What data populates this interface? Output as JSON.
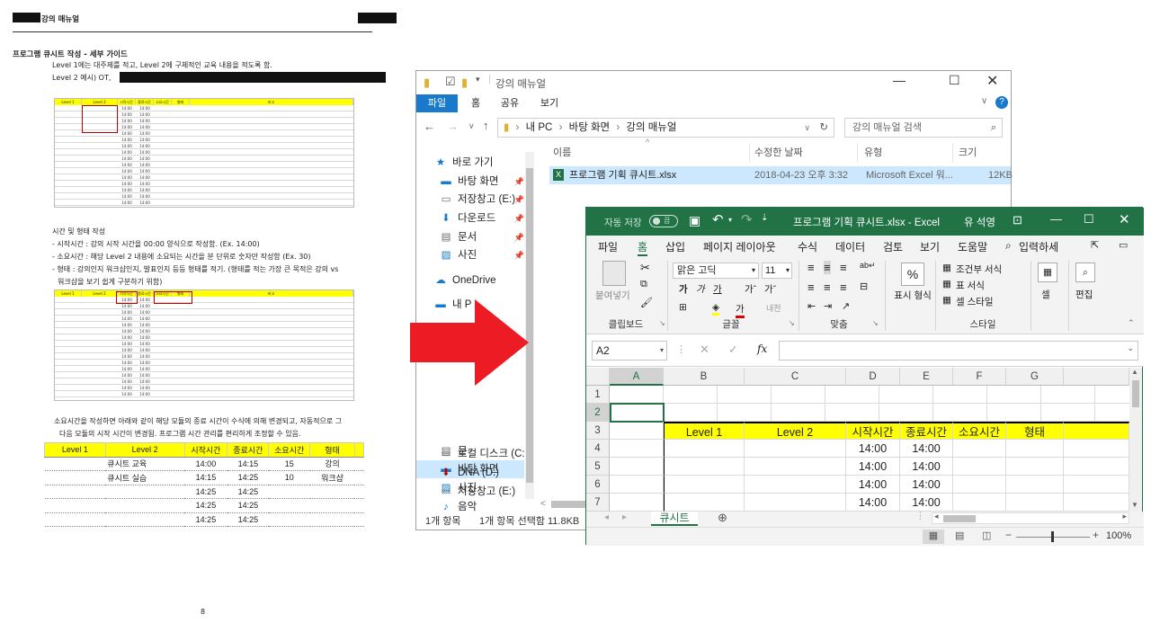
{
  "doc": {
    "header_title": "강의 매뉴얼",
    "section_title": "프로그램 큐시트 작성 - 세부 가이드",
    "intro_line1": "Level 1에는 대주제를 적고, Level 2에 구체적인 교육 내용을 적도록 함.",
    "intro_line2_prefix": "Level 2 예시) OT,",
    "mini_table1": {
      "headers": [
        "Level 1",
        "Level 2",
        "시작시간",
        "종료시간",
        "소요시간",
        "형태",
        "비고"
      ],
      "times": [
        "14:00",
        "14:00",
        "14:00",
        "14:00",
        "14:00",
        "14:00",
        "14:00",
        "14:00",
        "14:00",
        "14:00",
        "14:00",
        "14:00",
        "14:00",
        "14:00",
        "14:00",
        "14:00"
      ]
    },
    "time_section_title": "시간 및 형태 작성",
    "bullet1": "- 시작시간 : 강의 시작 시간을 00:00 양식으로 작성함. (Ex. 14:00)",
    "bullet2": "- 소요시간 : 해당 Level 2 내용에 소요되는 시간을 분 단위로 숫자만 작성함 (Ex. 30)",
    "bullet3a": "- 형태 : 강의인지 워크샵인지, 발표인지 등등 형태를 적기. (형태를 적는 가장 큰 목적은 강의 vs",
    "bullet3b": "워크샵을 보기 쉽게 구분하기 위함)",
    "para_a": "소요시간을 작성하면 아래와 같이 해당 모듈의 종료 시간이 수식에 의해 변경되고, 자동적으로 그",
    "para_b": "다음 모듈의 시작 시간이 변경됨. 프로그램 시간 관리를 편리하게 조정할 수 있음.",
    "table": {
      "headers": [
        "Level 1",
        "Level 2",
        "시작시간",
        "종료시간",
        "소요시간",
        "형태"
      ],
      "rows": [
        [
          "",
          "큐시트 교육",
          "14:00",
          "14:15",
          "15",
          "강의"
        ],
        [
          "",
          "큐시트 실습",
          "14:15",
          "14:25",
          "10",
          "워크샵"
        ],
        [
          "",
          "",
          "14:25",
          "14:25",
          "",
          ""
        ],
        [
          "",
          "",
          "14:25",
          "14:25",
          "",
          ""
        ],
        [
          "",
          "",
          "14:25",
          "14:25",
          "",
          ""
        ]
      ]
    },
    "page_number": "8"
  },
  "explorer": {
    "title": "강의 매뉴얼",
    "tabs": [
      "파일",
      "홈",
      "공유",
      "보기"
    ],
    "breadcrumb": [
      "내 PC",
      "바탕 화면",
      "강의 매뉴얼"
    ],
    "search_placeholder": "강의 매뉴얼 검색",
    "columns": [
      "이름",
      "수정한 날짜",
      "유형",
      "크기"
    ],
    "file": {
      "name": "프로그램 기획 큐시트.xlsx",
      "date": "2018-04-23 오후 3:32",
      "type": "Microsoft Excel 워...",
      "size": "12KB"
    },
    "nav": {
      "quick_access": "바로 가기",
      "items": [
        "바탕 화면",
        "저장창고 (E:)",
        "다운로드",
        "문서",
        "사진"
      ],
      "onedrive": "OneDrive",
      "this_pc_partial": "내 P",
      "docs_partial": "문",
      "desktop": "바탕 화면",
      "pictures": "사진",
      "music": "음악",
      "local_disk": "로컬 디스크 (C:)",
      "dna": "DNA (D:)",
      "storage": "저장창고 (E:)"
    },
    "status_count": "1개 항목",
    "status_selected": "1개 항목 선택함 11.8KB"
  },
  "excel": {
    "autosave": "자동 저장",
    "autosave_state": "끔",
    "title": "프로그램 기획 큐시트.xlsx  -  Excel",
    "user": "유 석영",
    "menu": [
      "파일",
      "홈",
      "삽입",
      "페이지 레이아웃",
      "수식",
      "데이터",
      "검토",
      "보기",
      "도움말"
    ],
    "tell_me": "입력하세",
    "font_name": "맑은 고딕",
    "font_size": "11",
    "groups": {
      "clipboard": "클립보드",
      "font": "글꼴",
      "align": "맞춤",
      "styles": "스타일"
    },
    "paste": "붙여넣기",
    "number_format": "표시 형식",
    "cond_format": "조건부 서식",
    "table_format": "표 서식",
    "cell_style": "셀 스타일",
    "cells": "셀",
    "editing": "편집",
    "name_box": "A2",
    "fx": "fx",
    "columns": [
      "A",
      "B",
      "C",
      "D",
      "E",
      "F",
      "G"
    ],
    "rows": [
      "1",
      "2",
      "3",
      "4",
      "5",
      "6",
      "7"
    ],
    "header_row": [
      "Level 1",
      "Level 2",
      "시작시간",
      "종료시간",
      "소요시간",
      "형태"
    ],
    "data_rows": [
      [
        "",
        "",
        "14:00",
        "14:00",
        "",
        ""
      ],
      [
        "",
        "",
        "14:00",
        "14:00",
        "",
        ""
      ],
      [
        "",
        "",
        "14:00",
        "14:00",
        "",
        ""
      ],
      [
        "",
        "",
        "14:00",
        "14:00",
        "",
        ""
      ]
    ],
    "sheet_tab": "큐시트",
    "zoom": "100%",
    "colors": {
      "green": "#217346",
      "yellow": "#ffff00"
    }
  }
}
